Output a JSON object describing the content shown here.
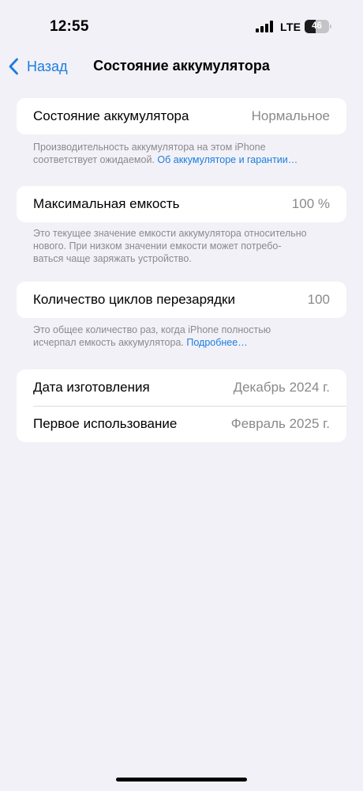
{
  "status_bar": {
    "time": "12:55",
    "network": "LTE",
    "battery_percent": "46",
    "battery_level": 0.46
  },
  "nav": {
    "back_label": "Назад",
    "title": "Состояние аккумулятора"
  },
  "health": {
    "label": "Состояние аккумулятора",
    "value": "Нормальное",
    "note_text": "Производительность аккумулятора на этом iPhone соответствует ожидаемой. ",
    "note_link": "Об аккумуляторе и гарантии…"
  },
  "capacity": {
    "label": "Максимальная емкость",
    "value": "100 %",
    "note_line1": "Это текущее значение емкости аккумулятора относительно",
    "note_line2": "нового. При низком значении емкости может потребо-",
    "note_line3": "ваться чаще заряжать устройство."
  },
  "cycles": {
    "label": "Количество циклов перезарядки",
    "value": "100",
    "note_line1": "Это общее количество раз, когда iPhone полностью",
    "note_line2": "исчерпал емкость аккумулятора. ",
    "note_link": "Подробнее…"
  },
  "dates": {
    "manufactured_label": "Дата изготовления",
    "manufactured_value": "Декабрь 2024 г.",
    "first_use_label": "Первое использование",
    "first_use_value": "Февраль 2025 г."
  },
  "colors": {
    "background": "#f2f1f7",
    "accent": "#1a7ee0",
    "secondary_text": "#8a8a8e"
  }
}
